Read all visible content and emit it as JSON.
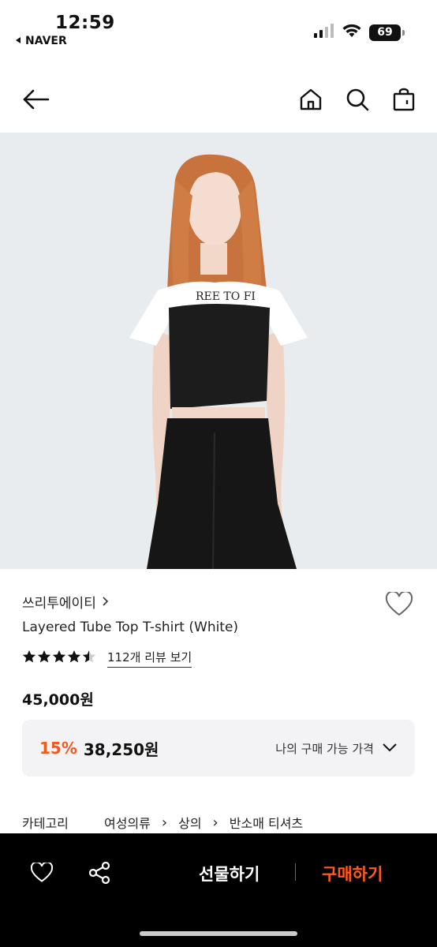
{
  "status_bar": {
    "time": "12:59",
    "back_app": "NAVER",
    "battery": "69"
  },
  "header": {
    "icons": [
      "back-arrow-icon",
      "home-icon",
      "search-icon",
      "shopping-bag-icon"
    ]
  },
  "product": {
    "brand": "쓰리투에이티",
    "title": "Layered Tube Top T-shirt (White)",
    "rating": 4.5,
    "review_link": "112개 리뷰 보기",
    "price": "45,000원",
    "discount_percent": "15%",
    "discount_price": "38,250원",
    "my_price_label": "나의 구매 가능 가격"
  },
  "category": {
    "label": "카테고리",
    "path": [
      "여성의류",
      "상의",
      "반소매 티셔츠"
    ]
  },
  "bottom_bar": {
    "gift_label": "선물하기",
    "buy_label": "구매하기"
  },
  "colors": {
    "accent": "#f25a1e",
    "buy": "#ff5a1f",
    "bottom_bar_bg": "#000000",
    "hero_bg": "#e9ecef"
  }
}
